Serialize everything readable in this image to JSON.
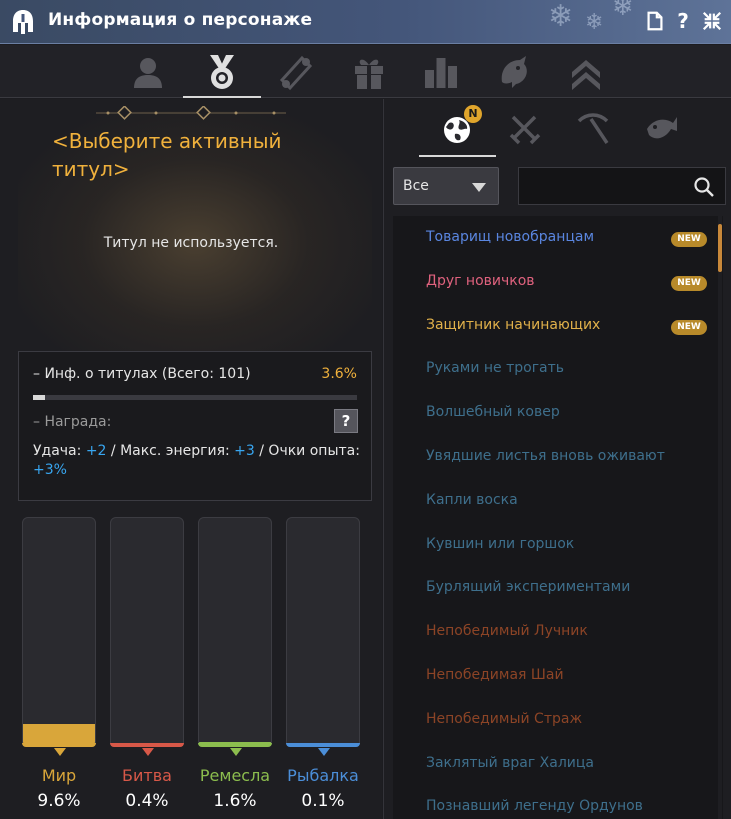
{
  "window": {
    "title": "Информация о персонаже"
  },
  "top_tabs": [
    {
      "icon": "person-icon",
      "active": false
    },
    {
      "icon": "medal-icon",
      "active": true
    },
    {
      "icon": "scroll-icon",
      "active": false
    },
    {
      "icon": "gift-icon",
      "active": false
    },
    {
      "icon": "bar-chart-icon",
      "active": false
    },
    {
      "icon": "dragon-icon",
      "active": false
    },
    {
      "icon": "rank-chevron-icon",
      "active": false
    }
  ],
  "left": {
    "hero_title": "<Выберите активный титул>",
    "hero_subtitle": "Титул не используется.",
    "info": {
      "label": "– Инф. о титулах (Всего: 101)",
      "percent": "3.6%",
      "progress": 0.036,
      "reward_label": "– Награда:",
      "help": "?",
      "bonus_part1": "Удача: ",
      "bonus_val1": "+2",
      "bonus_part2": " / Макс. энергия: ",
      "bonus_val2": "+3",
      "bonus_part3": " / Очки опыта: ",
      "bonus_val3": "+3%"
    },
    "categories": [
      {
        "name": "Мир",
        "value": "9.6%",
        "fraction": 0.096,
        "color": "#d9a63a"
      },
      {
        "name": "Битва",
        "value": "0.4%",
        "fraction": 0.004,
        "color": "#d85848"
      },
      {
        "name": "Ремесла",
        "value": "1.6%",
        "fraction": 0.016,
        "color": "#8cbd4e"
      },
      {
        "name": "Рыбалка",
        "value": "0.1%",
        "fraction": 0.001,
        "color": "#4b8ed8"
      }
    ]
  },
  "right": {
    "tabs": [
      {
        "icon": "globe-icon",
        "active": true,
        "badge": "N"
      },
      {
        "icon": "crossed-swords-icon",
        "active": false
      },
      {
        "icon": "pickaxe-icon",
        "active": false
      },
      {
        "icon": "fish-icon",
        "active": false
      }
    ],
    "filter_value": "Все",
    "search_placeholder": "",
    "titles": [
      {
        "text": "Товарищ новобранцам",
        "color": "#5a86e0",
        "new": "NEW"
      },
      {
        "text": "Друг новичков",
        "color": "#e0627e",
        "new": "NEW"
      },
      {
        "text": "Защитник начинающих",
        "color": "#e0b04a",
        "new": "NEW"
      },
      {
        "text": "Руками не трогать",
        "color": "#3e6f8c"
      },
      {
        "text": "Волшебный ковер",
        "color": "#3e6f8c"
      },
      {
        "text": "Увядшие листья вновь оживают",
        "color": "#3e6f8c"
      },
      {
        "text": "Капли воска",
        "color": "#3e6f8c"
      },
      {
        "text": "Кувшин или горшок",
        "color": "#3e6f8c"
      },
      {
        "text": "Бурлящий экспериментами",
        "color": "#3e6f8c"
      },
      {
        "text": "Непобедимый Лучник",
        "color": "#8c4426"
      },
      {
        "text": "Непобедимая Шай",
        "color": "#8c4426"
      },
      {
        "text": "Непобедимый Страж",
        "color": "#8c4426"
      },
      {
        "text": "Заклятый враг Халица",
        "color": "#3e6f8c"
      },
      {
        "text": "Познавший легенду Ордунов",
        "color": "#3e6f8c"
      }
    ]
  }
}
